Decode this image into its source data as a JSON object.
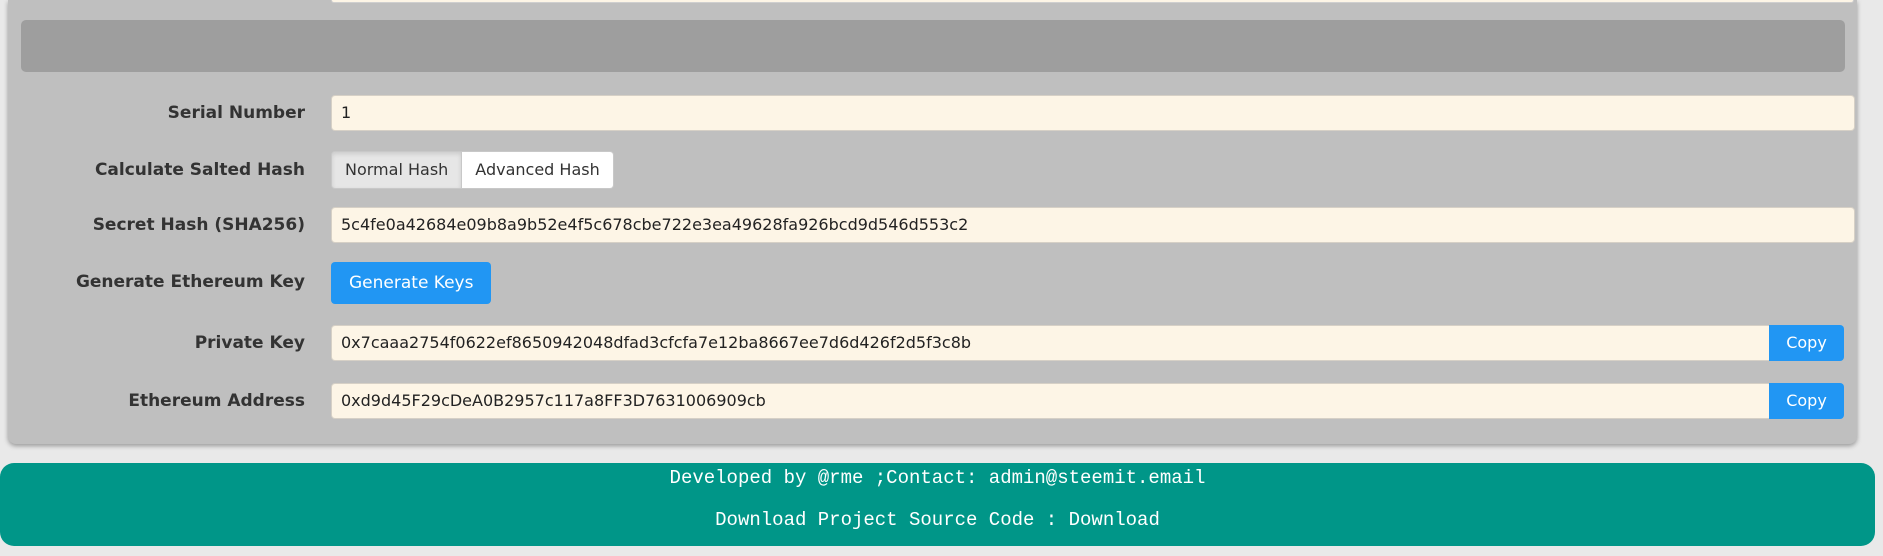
{
  "form": {
    "serial_number": {
      "label": "Serial Number",
      "value": "1"
    },
    "salted_hash": {
      "label": "Calculate Salted Hash",
      "options": [
        "Normal Hash",
        "Advanced Hash"
      ],
      "selected": "Normal Hash"
    },
    "secret_hash": {
      "label": "Secret Hash (SHA256)",
      "value": "5c4fe0a42684e09b8a9b52e4f5c678cbe722e3ea49628fa926bcd9d546d553c2"
    },
    "generate": {
      "label": "Generate Ethereum Key",
      "button_label": "Generate Keys"
    },
    "private_key": {
      "label": "Private Key",
      "value": "0x7caaa2754f0622ef8650942048dfad3cfcfa7e12ba8667ee7d6d426f2d5f3c8b",
      "copy_label": "Copy"
    },
    "ethereum_address": {
      "label": "Ethereum Address",
      "value": "0xd9d45F29cDeA0B2957c117a8FF3D7631006909cb",
      "copy_label": "Copy"
    }
  },
  "footer": {
    "developed_text": "Developed by @rme ;Contact: admin@steemit.email",
    "download_prefix": "Download Project Source Code : ",
    "download_link": "Download"
  },
  "colors": {
    "accent": "#2196f3",
    "footer_bg": "#009688",
    "input_bg": "#fdf5e6",
    "panel_bg": "#bfbfbf"
  }
}
